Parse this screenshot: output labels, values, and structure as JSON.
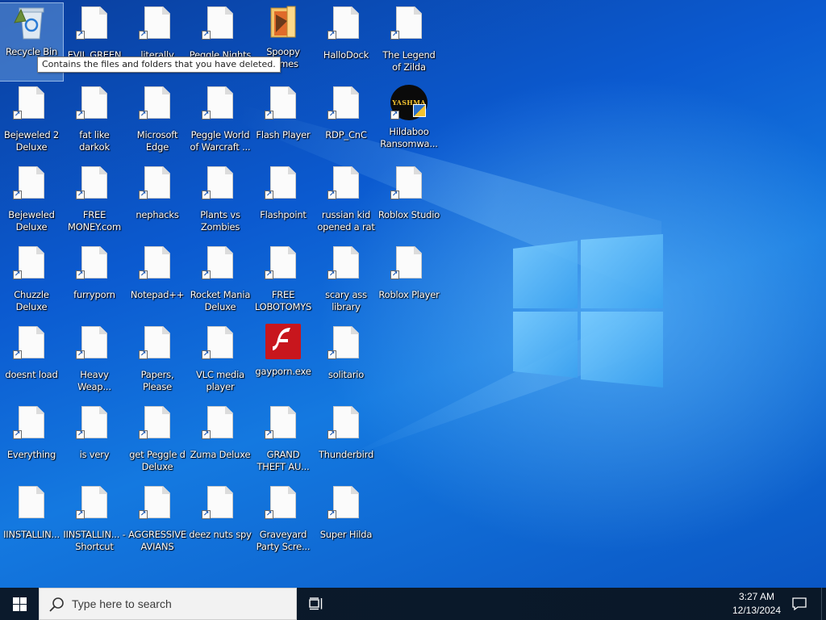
{
  "desktop": {
    "tooltip": "Contains the files and folders that you have deleted.",
    "icons": [
      {
        "label": "Recycle Bin",
        "type": "recycle",
        "shortcut": false,
        "selected": true
      },
      {
        "label": "EVIL GREEN",
        "type": "file",
        "shortcut": true
      },
      {
        "label": "literally",
        "type": "file",
        "shortcut": true
      },
      {
        "label": "Peggle Nights",
        "type": "file",
        "shortcut": true
      },
      {
        "label": "Spoopy games",
        "type": "folder",
        "shortcut": false
      },
      {
        "label": "HalloDock",
        "type": "file",
        "shortcut": true
      },
      {
        "label": "The Legend of Zilda",
        "type": "file",
        "shortcut": true
      },
      {
        "label": "Bejeweled 2 Deluxe",
        "type": "file",
        "shortcut": true
      },
      {
        "label": "fat like darkok",
        "type": "file",
        "shortcut": true
      },
      {
        "label": "Microsoft Edge",
        "type": "file",
        "shortcut": true
      },
      {
        "label": "Peggle World of Warcraft ...",
        "type": "file",
        "shortcut": true
      },
      {
        "label": "Flash Player",
        "type": "file",
        "shortcut": true
      },
      {
        "label": "RDP_CnC",
        "type": "file",
        "shortcut": true
      },
      {
        "label": "Hildaboo Ransomwa...",
        "type": "yashma",
        "shortcut": true,
        "badge": "YASHMA"
      },
      {
        "label": "Bejeweled Deluxe",
        "type": "file",
        "shortcut": true
      },
      {
        "label": "FREE MONEY.com",
        "type": "file",
        "shortcut": true
      },
      {
        "label": "nephacks",
        "type": "file",
        "shortcut": true
      },
      {
        "label": "Plants vs Zombies",
        "type": "file",
        "shortcut": true
      },
      {
        "label": "Flashpoint",
        "type": "file",
        "shortcut": true
      },
      {
        "label": "russian kid opened a rat",
        "type": "file",
        "shortcut": true
      },
      {
        "label": "Roblox Studio",
        "type": "file",
        "shortcut": true
      },
      {
        "label": "Chuzzle Deluxe",
        "type": "file",
        "shortcut": true
      },
      {
        "label": "furryporn",
        "type": "file",
        "shortcut": true
      },
      {
        "label": "Notepad++",
        "type": "file",
        "shortcut": true
      },
      {
        "label": "Rocket Mania Deluxe",
        "type": "file",
        "shortcut": true
      },
      {
        "label": "FREE LOBOTOMYS",
        "type": "file",
        "shortcut": true
      },
      {
        "label": "scary ass library",
        "type": "file",
        "shortcut": true
      },
      {
        "label": "Roblox Player",
        "type": "file",
        "shortcut": true
      },
      {
        "label": "doesnt load",
        "type": "file",
        "shortcut": true
      },
      {
        "label": "Heavy Weap...",
        "type": "file",
        "shortcut": true
      },
      {
        "label": "Papers, Please",
        "type": "file",
        "shortcut": true
      },
      {
        "label": "VLC media player",
        "type": "file",
        "shortcut": true
      },
      {
        "label": "gayporn.exe",
        "type": "flash",
        "shortcut": false
      },
      {
        "label": "solitario",
        "type": "file",
        "shortcut": true
      },
      {
        "label": "Everything",
        "type": "file",
        "shortcut": true
      },
      {
        "label": "is very",
        "type": "file",
        "shortcut": true
      },
      {
        "label": "get Peggle d Deluxe",
        "type": "file",
        "shortcut": true
      },
      {
        "label": "Zuma Deluxe",
        "type": "file",
        "shortcut": true
      },
      {
        "label": "GRAND THEFT AU...",
        "type": "file",
        "shortcut": true
      },
      {
        "label": "Thunderbird",
        "type": "file",
        "shortcut": true
      },
      {
        "label": "IINSTALLIN...",
        "type": "file",
        "shortcut": false
      },
      {
        "label": "IINSTALLIN... - Shortcut",
        "type": "file",
        "shortcut": true
      },
      {
        "label": "AGGRESSIVE AVIANS",
        "type": "file",
        "shortcut": true
      },
      {
        "label": "deez nuts spy",
        "type": "file",
        "shortcut": true
      },
      {
        "label": "Graveyard Party Scre...",
        "type": "file",
        "shortcut": true
      },
      {
        "label": "Super Hilda",
        "type": "file",
        "shortcut": true
      }
    ]
  },
  "taskbar": {
    "search_placeholder": "Type here to search",
    "time": "3:27 AM",
    "date": "12/13/2024"
  },
  "colors": {
    "taskbar_bg": "#0b1a2c",
    "wallpaper_accent": "#1479e0",
    "flash_red": "#c8161d"
  }
}
